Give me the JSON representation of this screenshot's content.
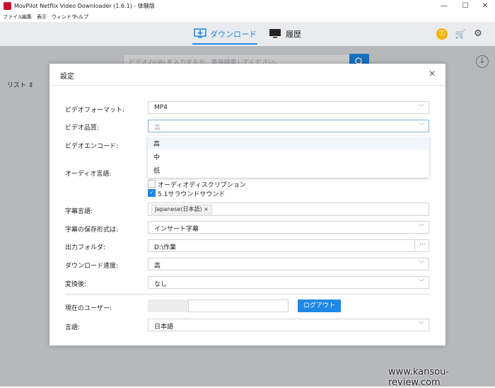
{
  "window": {
    "title": "MovPilot Netflix Video Downloader (1.6.1) - 体験版",
    "controls": {
      "minimize": "—",
      "maximize": "☐",
      "close": "✕"
    }
  },
  "menu": [
    "ファイル",
    "編集",
    "表示",
    "ウィンドウ",
    "ヘルプ"
  ],
  "header": {
    "tabs": [
      {
        "label": "ダウンロード",
        "active": true,
        "icon": "download-monitor-icon"
      },
      {
        "label": "履歴",
        "active": false,
        "icon": "monitor-icon"
      }
    ],
    "right_icons": [
      "key-icon",
      "cart-icon",
      "gear-icon"
    ]
  },
  "main": {
    "search_placeholder": "ビデオのURLを入力するか、直接検索してください。",
    "list_label": "リスト ⇕"
  },
  "dialog": {
    "title": "設定",
    "close": "✕",
    "rows": {
      "video_format": {
        "label": "ビデオフォーマット:",
        "value": "MP4"
      },
      "video_quality": {
        "label": "ビデオ品質:",
        "value": "高"
      },
      "video_encode": {
        "label": "ビデオエンコード:"
      },
      "audio_lang": {
        "label": "オーディオ言語:"
      },
      "audio_desc": {
        "label": "オーディオディスクリプション",
        "checked": false
      },
      "surround": {
        "label": "5.1サラウンドサウンド",
        "checked": true
      },
      "subtitle_lang": {
        "label": "字幕言語:",
        "tag": "Japanese(日本語)",
        "tag_remove": "×"
      },
      "subtitle_save": {
        "label": "字幕の保存形式は:",
        "value": "インサート字幕"
      },
      "output_folder": {
        "label": "出力フォルダ:",
        "value": "D:\\作業",
        "browse": "···"
      },
      "download_speed": {
        "label": "ダウンロード速度:",
        "value": "高"
      },
      "after_convert": {
        "label": "変換後:",
        "value": "なし"
      },
      "current_user": {
        "label": "現在のユーザー:",
        "logout": "ログアウト"
      },
      "language": {
        "label": "言語:",
        "value": "日本語"
      }
    },
    "quality_options": [
      "高",
      "中",
      "低"
    ]
  },
  "watermark": "www.kansou-review.com",
  "colors": {
    "accent": "#1e88e5"
  }
}
